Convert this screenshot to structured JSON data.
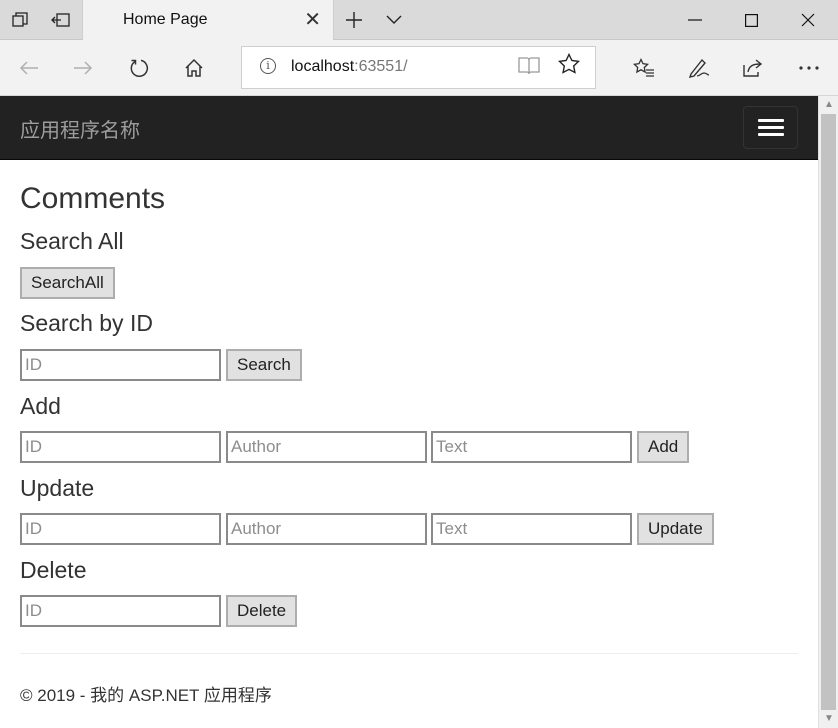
{
  "browser": {
    "tab_title": "Home Page",
    "address_host": "localhost",
    "address_port": ":63551/",
    "icons": {
      "tab_manage": "tabs-icon",
      "set_aside": "set-aside-icon",
      "new_tab": "+",
      "tab_list": "chevron-down-icon",
      "minimize": "minimize-icon",
      "maximize": "maximize-icon",
      "close": "close-icon",
      "back": "back-arrow-icon",
      "forward": "forward-arrow-icon",
      "refresh": "refresh-icon",
      "home": "home-icon",
      "info": "info-icon",
      "reading_view": "reading-view-icon",
      "favorite": "star-icon",
      "favorites_hub": "favorites-list-icon",
      "notes": "pen-icon",
      "share": "share-icon",
      "more": "more-icon"
    }
  },
  "app": {
    "brand": "应用程序名称",
    "colors": {
      "navbar_bg": "#222222",
      "brand_text": "#9d9d9d"
    }
  },
  "page": {
    "title": "Comments",
    "search_all": {
      "heading": "Search All",
      "button": "SearchAll"
    },
    "search_by_id": {
      "heading": "Search by ID",
      "id_placeholder": "ID",
      "button": "Search"
    },
    "add": {
      "heading": "Add",
      "id_placeholder": "ID",
      "author_placeholder": "Author",
      "text_placeholder": "Text",
      "button": "Add"
    },
    "update": {
      "heading": "Update",
      "id_placeholder": "ID",
      "author_placeholder": "Author",
      "text_placeholder": "Text",
      "button": "Update"
    },
    "delete": {
      "heading": "Delete",
      "id_placeholder": "ID",
      "button": "Delete"
    },
    "footer": "© 2019 - 我的 ASP.NET 应用程序"
  }
}
